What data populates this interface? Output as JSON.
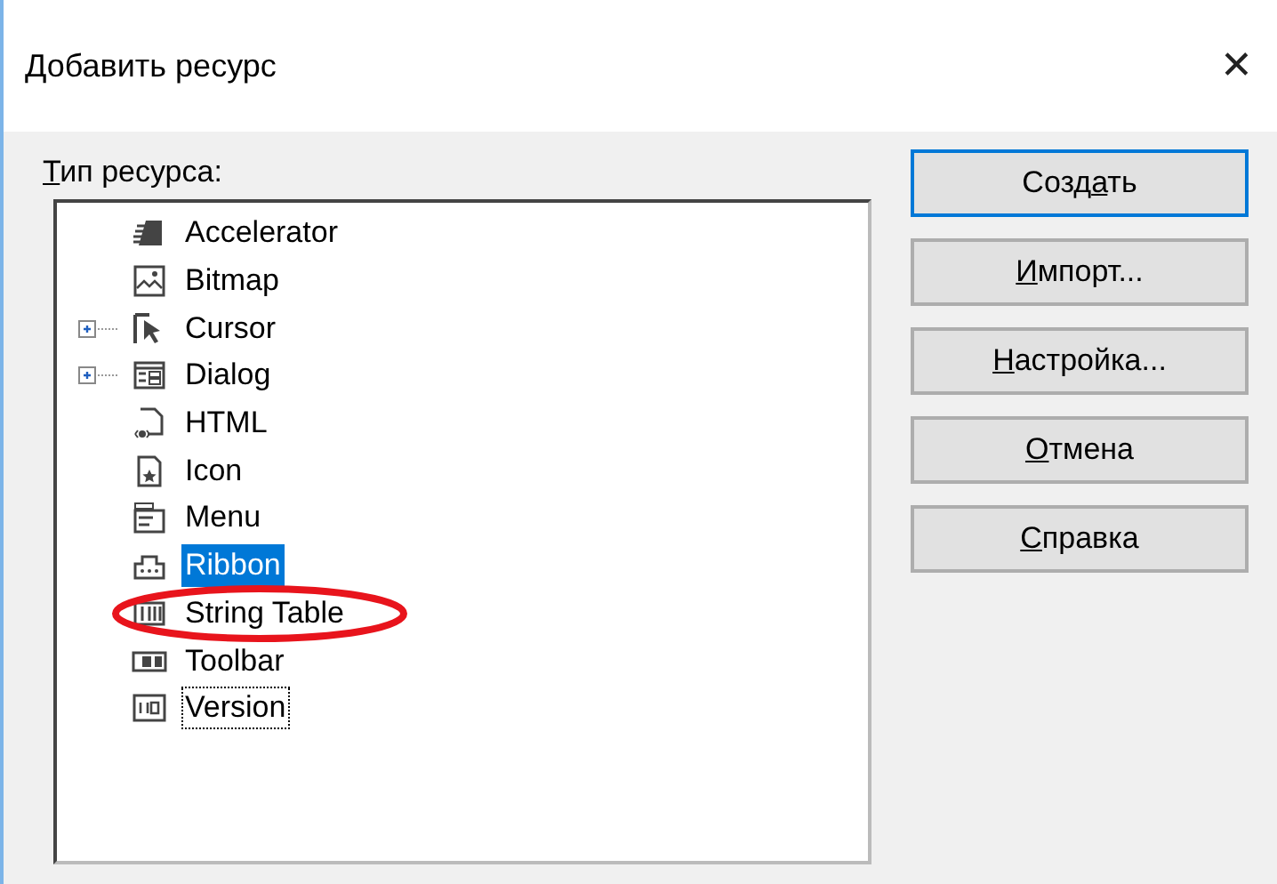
{
  "window": {
    "title": "Добавить ресурс",
    "close": "✕"
  },
  "list_label": {
    "key": "Т",
    "post": "ип ресурса:"
  },
  "tree": {
    "items": [
      {
        "kind": "accelerator",
        "label": "Accelerator",
        "expandable": false,
        "selected": false,
        "focused": false,
        "circled": false
      },
      {
        "kind": "bitmap",
        "label": "Bitmap",
        "expandable": false,
        "selected": false,
        "focused": false,
        "circled": false
      },
      {
        "kind": "cursor",
        "label": "Cursor",
        "expandable": true,
        "selected": false,
        "focused": false,
        "circled": false
      },
      {
        "kind": "dialog",
        "label": "Dialog",
        "expandable": true,
        "selected": false,
        "focused": false,
        "circled": false
      },
      {
        "kind": "html",
        "label": "HTML",
        "expandable": false,
        "selected": false,
        "focused": false,
        "circled": false
      },
      {
        "kind": "icon",
        "label": "Icon",
        "expandable": false,
        "selected": false,
        "focused": false,
        "circled": false
      },
      {
        "kind": "menu",
        "label": "Menu",
        "expandable": false,
        "selected": false,
        "focused": false,
        "circled": false
      },
      {
        "kind": "ribbon",
        "label": "Ribbon",
        "expandable": false,
        "selected": true,
        "focused": false,
        "circled": false
      },
      {
        "kind": "string_table",
        "label": "String Table",
        "expandable": false,
        "selected": false,
        "focused": false,
        "circled": true
      },
      {
        "kind": "toolbar",
        "label": "Toolbar",
        "expandable": false,
        "selected": false,
        "focused": false,
        "circled": false
      },
      {
        "kind": "version",
        "label": "Version",
        "expandable": false,
        "selected": false,
        "focused": true,
        "circled": false
      }
    ]
  },
  "buttons": [
    {
      "pre": "Созд",
      "key": "а",
      "post": "ть",
      "default": true
    },
    {
      "key": "И",
      "post": "мпорт...",
      "default": false
    },
    {
      "key": "Н",
      "post": "астройка...",
      "default": false
    },
    {
      "key": "О",
      "post": "тмена",
      "default": false
    },
    {
      "key": "С",
      "post": "правка",
      "default": false
    }
  ]
}
